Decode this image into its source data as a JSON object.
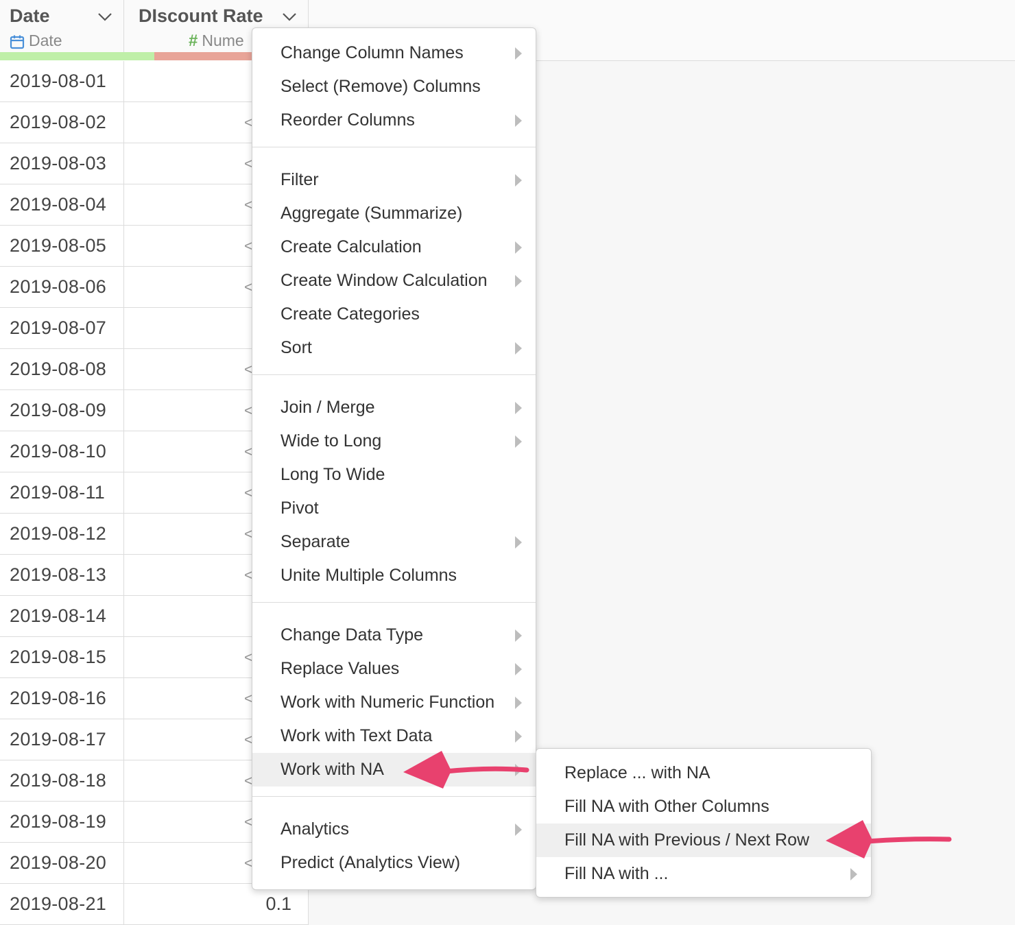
{
  "columns": [
    {
      "name": "Date",
      "type": "Date",
      "type_icon": "calendar-icon",
      "quality_color": "#bfefa8"
    },
    {
      "name": "DIscount Rate",
      "type": "Nume",
      "type_icon": "hash-icon",
      "quality_color": "#e8a498"
    }
  ],
  "rows": [
    {
      "date": "2019-08-01",
      "value": "",
      "frag": ""
    },
    {
      "date": "2019-08-02",
      "value": "",
      "frag": "<"
    },
    {
      "date": "2019-08-03",
      "value": "",
      "frag": "<"
    },
    {
      "date": "2019-08-04",
      "value": "",
      "frag": "<"
    },
    {
      "date": "2019-08-05",
      "value": "",
      "frag": "<"
    },
    {
      "date": "2019-08-06",
      "value": "",
      "frag": "<"
    },
    {
      "date": "2019-08-07",
      "value": "",
      "frag": ""
    },
    {
      "date": "2019-08-08",
      "value": "",
      "frag": "<"
    },
    {
      "date": "2019-08-09",
      "value": "",
      "frag": "<"
    },
    {
      "date": "2019-08-10",
      "value": "",
      "frag": "<"
    },
    {
      "date": "2019-08-11",
      "value": "",
      "frag": "<"
    },
    {
      "date": "2019-08-12",
      "value": "",
      "frag": "<"
    },
    {
      "date": "2019-08-13",
      "value": "",
      "frag": "<"
    },
    {
      "date": "2019-08-14",
      "value": "",
      "frag": ""
    },
    {
      "date": "2019-08-15",
      "value": "",
      "frag": "<"
    },
    {
      "date": "2019-08-16",
      "value": "",
      "frag": "<"
    },
    {
      "date": "2019-08-17",
      "value": "",
      "frag": "<"
    },
    {
      "date": "2019-08-18",
      "value": "",
      "frag": "<"
    },
    {
      "date": "2019-08-19",
      "value": "",
      "frag": "<"
    },
    {
      "date": "2019-08-20",
      "value": "",
      "frag": "<"
    },
    {
      "date": "2019-08-21",
      "value": "0.1",
      "frag": ""
    }
  ],
  "main_menu": {
    "groups": [
      [
        {
          "label": "Change Column Names",
          "submenu": true
        },
        {
          "label": "Select (Remove) Columns",
          "submenu": false
        },
        {
          "label": "Reorder Columns",
          "submenu": true
        }
      ],
      [
        {
          "label": "Filter",
          "submenu": true
        },
        {
          "label": "Aggregate (Summarize)",
          "submenu": false
        },
        {
          "label": "Create Calculation",
          "submenu": true
        },
        {
          "label": "Create Window Calculation",
          "submenu": true
        },
        {
          "label": "Create Categories",
          "submenu": false
        },
        {
          "label": "Sort",
          "submenu": true
        }
      ],
      [
        {
          "label": "Join / Merge",
          "submenu": true
        },
        {
          "label": "Wide to Long",
          "submenu": true
        },
        {
          "label": "Long To Wide",
          "submenu": false
        },
        {
          "label": "Pivot",
          "submenu": false
        },
        {
          "label": "Separate",
          "submenu": true
        },
        {
          "label": "Unite Multiple Columns",
          "submenu": false
        }
      ],
      [
        {
          "label": "Change Data Type",
          "submenu": true
        },
        {
          "label": "Replace Values",
          "submenu": true
        },
        {
          "label": "Work with Numeric Function",
          "submenu": true
        },
        {
          "label": "Work with Text Data",
          "submenu": true
        },
        {
          "label": "Work with NA",
          "submenu": true,
          "highlighted": true
        }
      ],
      [
        {
          "label": "Analytics",
          "submenu": true
        },
        {
          "label": "Predict (Analytics View)",
          "submenu": false
        }
      ]
    ]
  },
  "sub_menu": {
    "items": [
      {
        "label": "Replace ... with NA",
        "submenu": false
      },
      {
        "label": "Fill NA with Other Columns",
        "submenu": false
      },
      {
        "label": "Fill NA with Previous / Next Row",
        "submenu": false,
        "highlighted": true
      },
      {
        "label": "Fill NA with ...",
        "submenu": true
      }
    ]
  },
  "colors": {
    "annotation_arrow": "#e8416e",
    "calendar_icon": "#4a90d9",
    "hash_icon": "#6bb35a"
  }
}
